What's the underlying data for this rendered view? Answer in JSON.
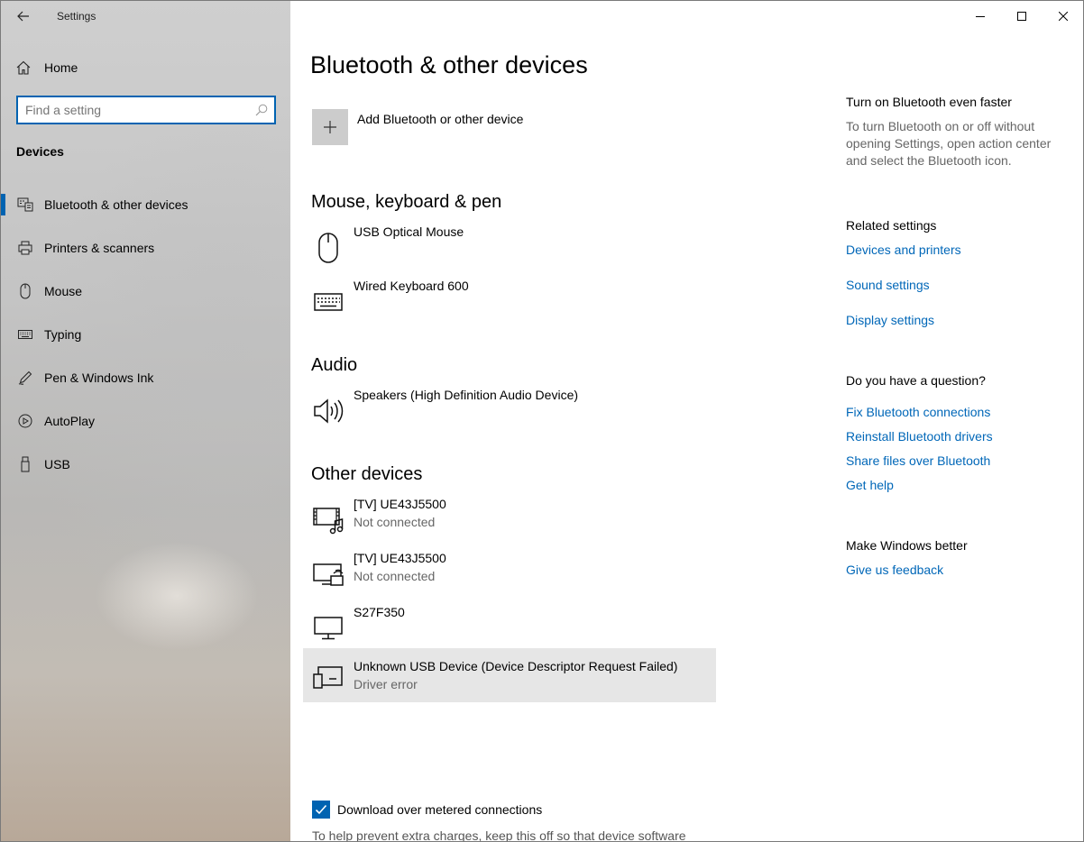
{
  "window": {
    "app_title": "Settings",
    "controls": [
      "minimize-icon",
      "maximize-icon",
      "close-icon"
    ]
  },
  "sidebar": {
    "home_label": "Home",
    "search": {
      "placeholder": "Find a setting",
      "value": ""
    },
    "section_heading": "Devices",
    "items": [
      {
        "label": "Bluetooth & other devices",
        "icon": "bluetooth-devices-icon",
        "active": true
      },
      {
        "label": "Printers & scanners",
        "icon": "printer-icon",
        "active": false
      },
      {
        "label": "Mouse",
        "icon": "mouse-icon",
        "active": false
      },
      {
        "label": "Typing",
        "icon": "keyboard-icon",
        "active": false
      },
      {
        "label": "Pen & Windows Ink",
        "icon": "pen-icon",
        "active": false
      },
      {
        "label": "AutoPlay",
        "icon": "autoplay-icon",
        "active": false
      },
      {
        "label": "USB",
        "icon": "usb-icon",
        "active": false
      }
    ]
  },
  "main": {
    "title": "Bluetooth & other devices",
    "add_device_label": "Add Bluetooth or other device",
    "groups": {
      "mouse_keyboard": {
        "title": "Mouse, keyboard & pen",
        "devices": [
          {
            "name": "USB Optical Mouse",
            "status": "",
            "icon": "mouse-icon"
          },
          {
            "name": "Wired Keyboard 600",
            "status": "",
            "icon": "keyboard-icon"
          }
        ]
      },
      "audio": {
        "title": "Audio",
        "devices": [
          {
            "name": "Speakers (High Definition Audio Device)",
            "status": "",
            "icon": "speaker-icon"
          }
        ]
      },
      "other": {
        "title": "Other devices",
        "devices": [
          {
            "name": "[TV] UE43J5500",
            "status": "Not connected",
            "icon": "media-device-icon"
          },
          {
            "name": "[TV] UE43J5500",
            "status": "Not connected",
            "icon": "wireless-display-icon"
          },
          {
            "name": "S27F350",
            "status": "",
            "icon": "monitor-icon"
          },
          {
            "name": "Unknown USB Device (Device Descriptor Request Failed)",
            "status": "Driver error",
            "icon": "generic-device-icon",
            "selected": true
          }
        ]
      }
    },
    "metered": {
      "label": "Download over metered connections",
      "checked": true,
      "help": "To help prevent extra charges, keep this off so that device software"
    }
  },
  "right": {
    "tip_heading": "Turn on Bluetooth even faster",
    "tip_text": "To turn Bluetooth on or off without opening Settings, open action center and select the Bluetooth icon.",
    "related_heading": "Related settings",
    "related_links": [
      "Devices and printers",
      "Sound settings",
      "Display settings"
    ],
    "question_heading": "Do you have a question?",
    "question_links": [
      "Fix Bluetooth connections",
      "Reinstall Bluetooth drivers",
      "Share files over Bluetooth",
      "Get help"
    ],
    "feedback_heading": "Make Windows better",
    "feedback_link": "Give us feedback"
  },
  "colors": {
    "accent": "#0063b1",
    "link": "#0067b8",
    "selected_row": "#e6e6e6"
  }
}
